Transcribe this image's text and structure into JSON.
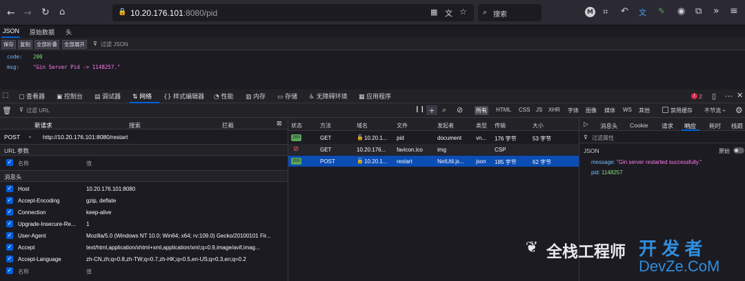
{
  "browser": {
    "url_host": "10.20.176.101",
    "url_rest": ":8080/pid",
    "search_placeholder": "搜索",
    "accent": "#0060df"
  },
  "json_viewer": {
    "tabs": [
      "JSON",
      "原始数据",
      "头"
    ],
    "buttons": [
      "保存",
      "复制",
      "全部折叠",
      "全部展开"
    ],
    "filter_placeholder": "过滤 JSON",
    "lines": [
      {
        "key": "code:",
        "value": "200"
      },
      {
        "key": "msg:",
        "value": "\"Gin Server Pid ->  1148257.\""
      }
    ]
  },
  "devtools": {
    "tabs": [
      "查看器",
      "控制台",
      "调试器",
      "网络",
      "样式编辑器",
      "性能",
      "内存",
      "存储",
      "无障碍环境",
      "应用程序"
    ],
    "selected_tab": "网络",
    "error_count": "2",
    "filter_placeholder": "过滤 URL",
    "type_filters": [
      "所有",
      "HTML",
      "CSS",
      "JS",
      "XHR",
      "字体",
      "图像",
      "媒体",
      "WS",
      "其他"
    ],
    "disable_cache": "禁用缓存",
    "throttle": "不节流 ÷"
  },
  "new_request": {
    "tabs": [
      "新请求",
      "搜索",
      "拦截"
    ],
    "method": "POST",
    "url": "http://10.20.176.101:8080/restart",
    "url_params_title": "URL 参数",
    "name_label": "名称",
    "value_label": "值",
    "headers_title": "消息头",
    "headers": [
      {
        "name": "Host",
        "value": "10.20.176.101:8080"
      },
      {
        "name": "Accept-Encoding",
        "value": "gzip, deflate"
      },
      {
        "name": "Connection",
        "value": "keep-alive"
      },
      {
        "name": "Upgrade-Insecure-Re...",
        "value": "1"
      },
      {
        "name": "User-Agent",
        "value": "Mozilla/5.0 (Windows NT 10.0; Win64; x64; rv:109.0) Gecko/20100101 Fir..."
      },
      {
        "name": "Accept",
        "value": "text/html,application/xhtml+xml,application/xml;q=0.9,image/avif,imag..."
      },
      {
        "name": "Accept-Language",
        "value": "zh-CN,zh;q=0.8,zh-TW;q=0.7,zh-HK;q=0.5,en-US;q=0.3,en;q=0.2"
      }
    ],
    "last_row": {
      "name": "名称",
      "value": "值"
    }
  },
  "network": {
    "columns": [
      "状态",
      "方法",
      "域名",
      "文件",
      "发起者",
      "类型",
      "传输",
      "大小"
    ],
    "rows": [
      {
        "status": "200",
        "method": "GET",
        "domain": "10.20.1...",
        "file": "pid",
        "initiator": "document",
        "type": "vn...",
        "transfer": "176 字节",
        "size": "53 字节",
        "blocked": false,
        "selected": false
      },
      {
        "status": "",
        "method": "GET",
        "domain": "10.20.176...",
        "file": "favicon.ico",
        "initiator": "img",
        "type": "",
        "transfer": "CSP",
        "size": "",
        "blocked": true,
        "selected": false
      },
      {
        "status": "200",
        "method": "POST",
        "domain": "10.20.1...",
        "file": "restart",
        "initiator": "NetUtil.js...",
        "type": "json",
        "transfer": "185 字节",
        "size": "62 字节",
        "blocked": false,
        "selected": true
      }
    ]
  },
  "response": {
    "tabs": [
      "消息头",
      "Cookie",
      "请求",
      "响应",
      "耗时",
      "栈跟"
    ],
    "selected_tab": "响应",
    "filter_placeholder": "过滤属性",
    "section": "JSON",
    "raw_label": "原始",
    "lines": [
      {
        "key": "message:",
        "value": "\"Gin server restarted successfully.\""
      },
      {
        "key": "pid:",
        "value": "1148257"
      }
    ]
  },
  "watermark": {
    "left_text": "全栈工程师",
    "right_top": "开 发 者",
    "right_bottom": "DevZe.CoM"
  }
}
